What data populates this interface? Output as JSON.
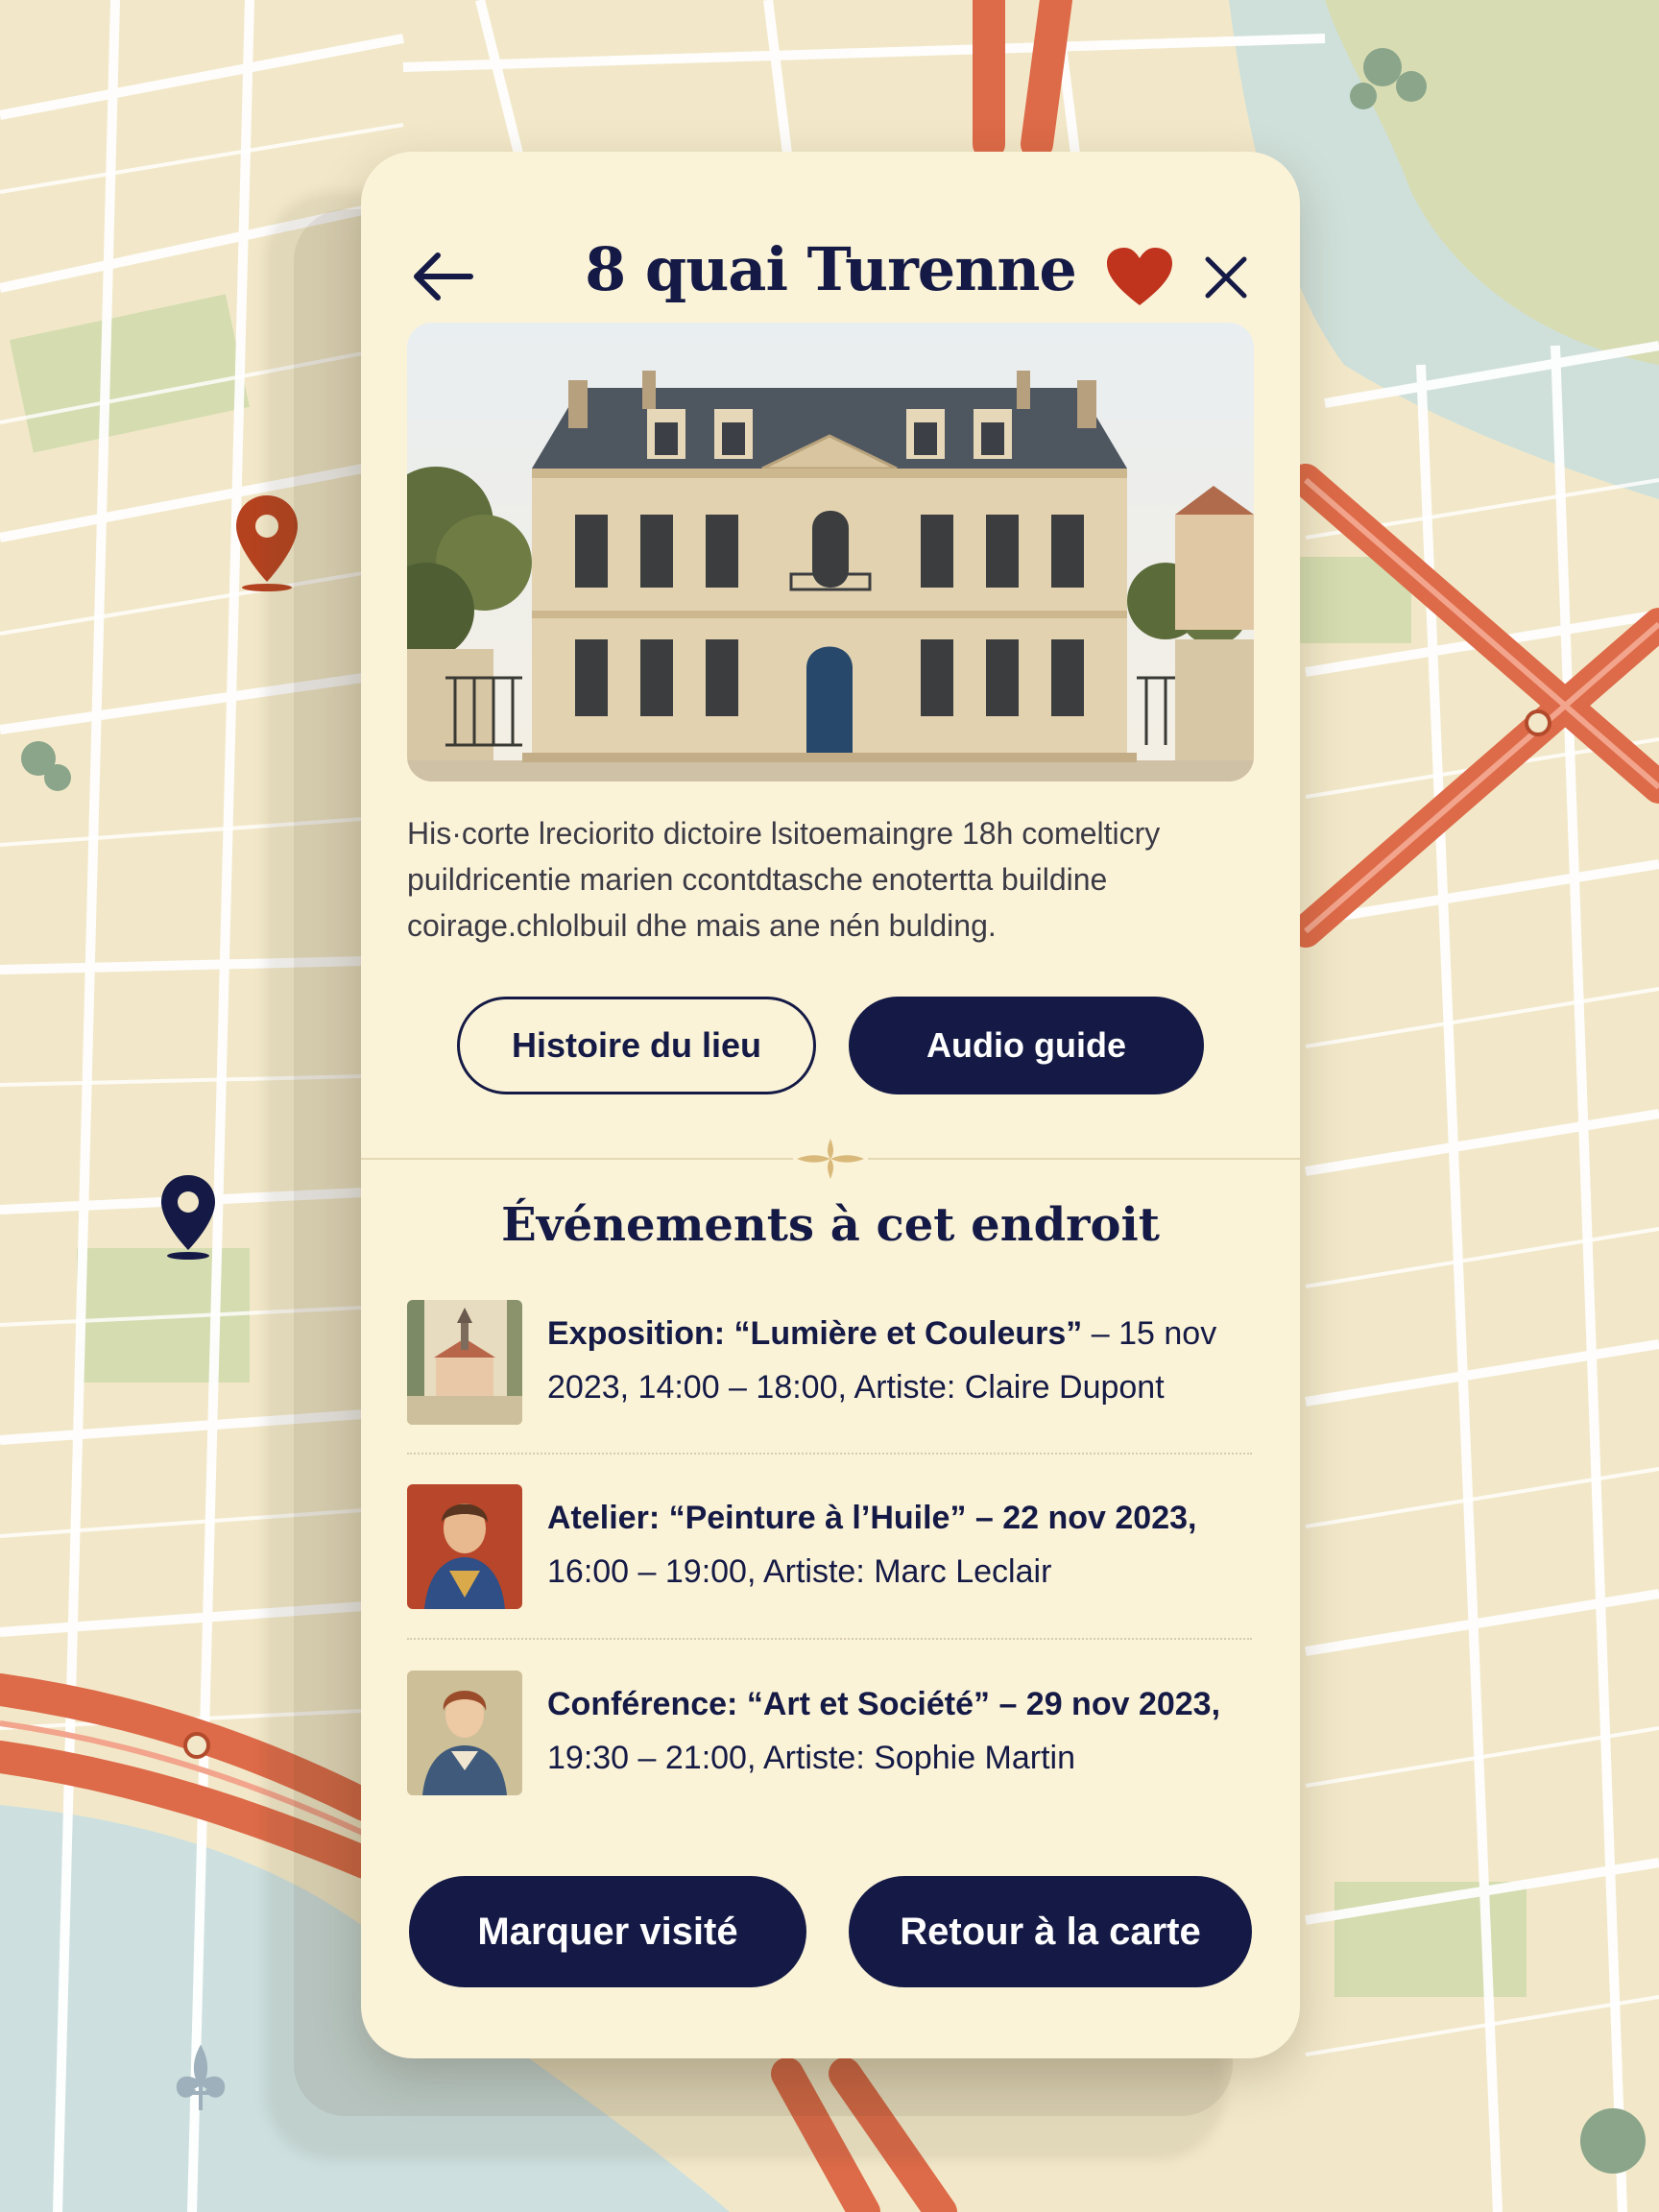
{
  "place": {
    "title": "8 quai Turenne",
    "description": "His·corte lreciorito dictoire lsitoemaingre 18h comelticry puildricentie marien ccontdtasche enotertta buildine coirage.chlolbuil dhe mais ane nén bulding."
  },
  "actions": {
    "history_label": "Histoire du lieu",
    "audio_label": "Audio guide",
    "mark_visited_label": "Marquer visité",
    "back_to_map_label": "Retour à la carte"
  },
  "events": {
    "heading": "Événements à cet endroit",
    "items": [
      {
        "line1_bold": "Exposition: “Lumière et Couleurs”",
        "line1_tail": " – 15 nov",
        "line2": "2023, 14:00 – 18:00, Artiste: Claire Dupont"
      },
      {
        "line1_bold": "Atelier: “Peinture à l’Huile” – 22 nov 2023,",
        "line1_tail": "",
        "line2": "16:00 – 19:00, Artiste: Marc Leclair"
      },
      {
        "line1_bold": "Conférence: “Art et Société” – 29 nov 2023,",
        "line1_tail": "",
        "line2": "19:30 – 21:00, Artiste: Sophie Martin"
      }
    ]
  },
  "colors": {
    "accent_navy": "#141a45",
    "favorite_red": "#c0331d",
    "map_road_orange": "#dd6a48",
    "card_background": "#fbf3d8"
  },
  "icons": [
    "back-arrow-icon",
    "heart-icon",
    "close-icon",
    "ornament-icon",
    "map-pin-icon",
    "fleur-de-lis-icon"
  ]
}
